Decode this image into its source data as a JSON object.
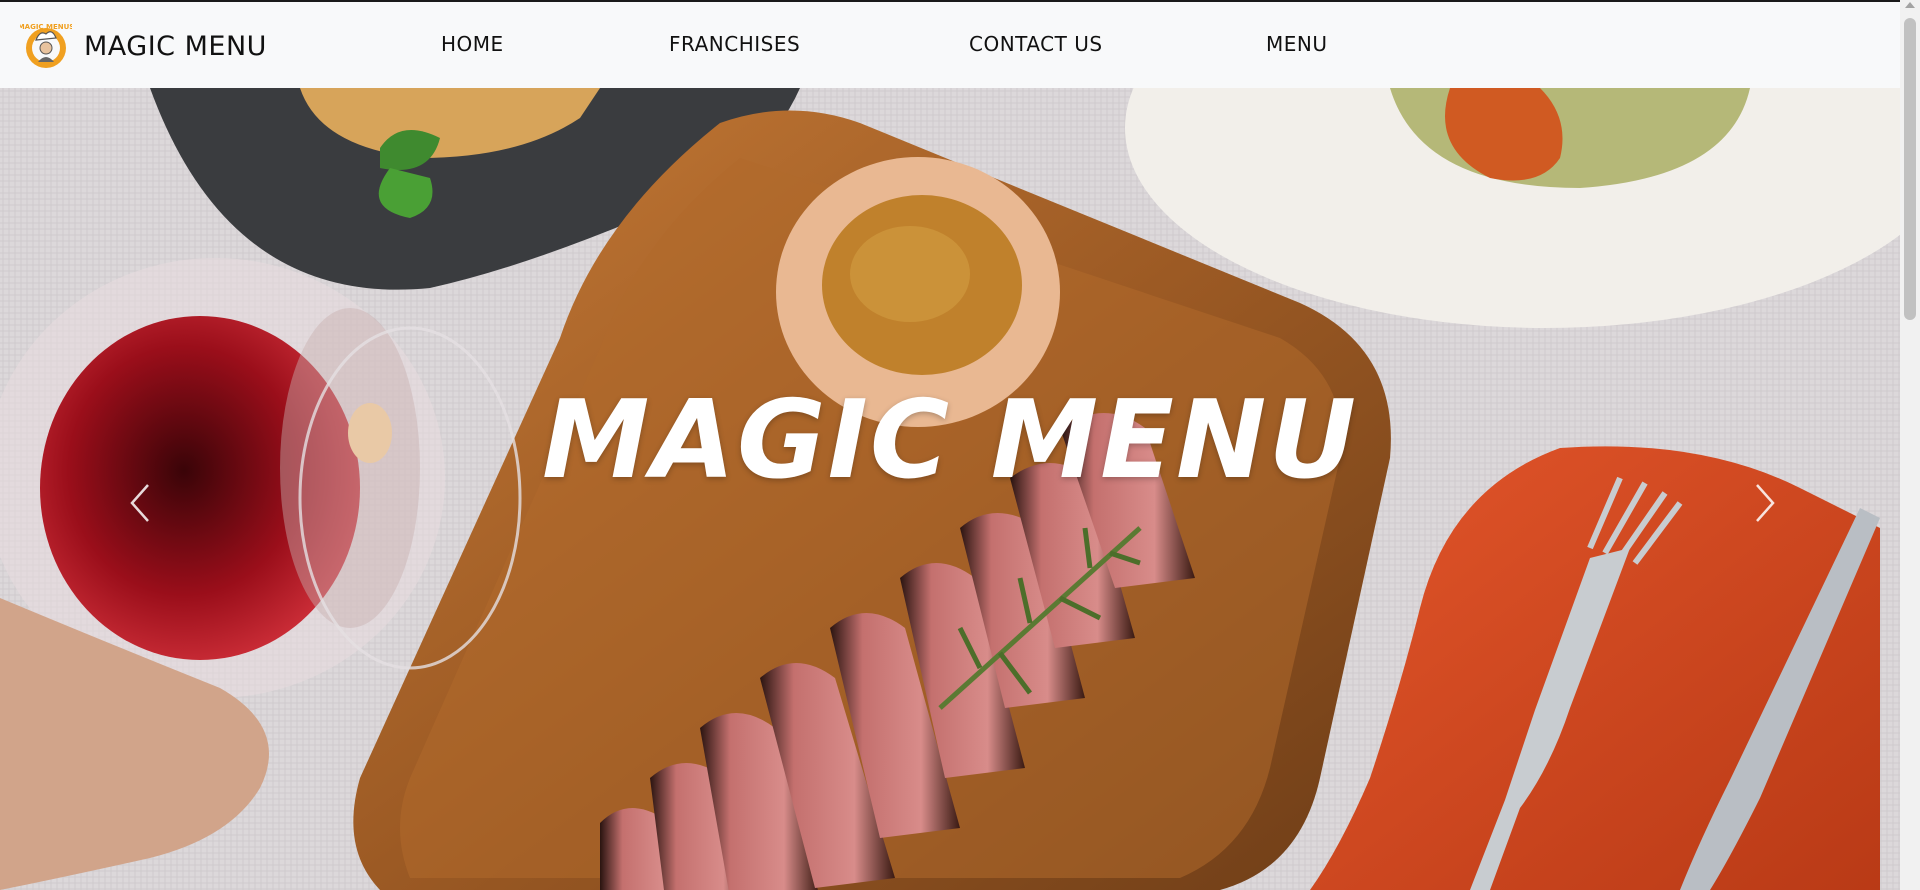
{
  "navbar": {
    "brand_text": "MAGIC MENU",
    "logo_text": "MAGIC MENUS",
    "links": [
      {
        "label": "HOME"
      },
      {
        "label": "FRANCHISES"
      },
      {
        "label": "CONTACT US"
      },
      {
        "label": "MENU"
      }
    ]
  },
  "hero": {
    "title": "MAGIC MENU",
    "prev_icon": "chevron-left-icon",
    "next_icon": "chevron-right-icon"
  },
  "colors": {
    "navbar_bg": "#f8f9fa",
    "logo_accent": "#f0a020",
    "title_text": "#ffffff"
  }
}
